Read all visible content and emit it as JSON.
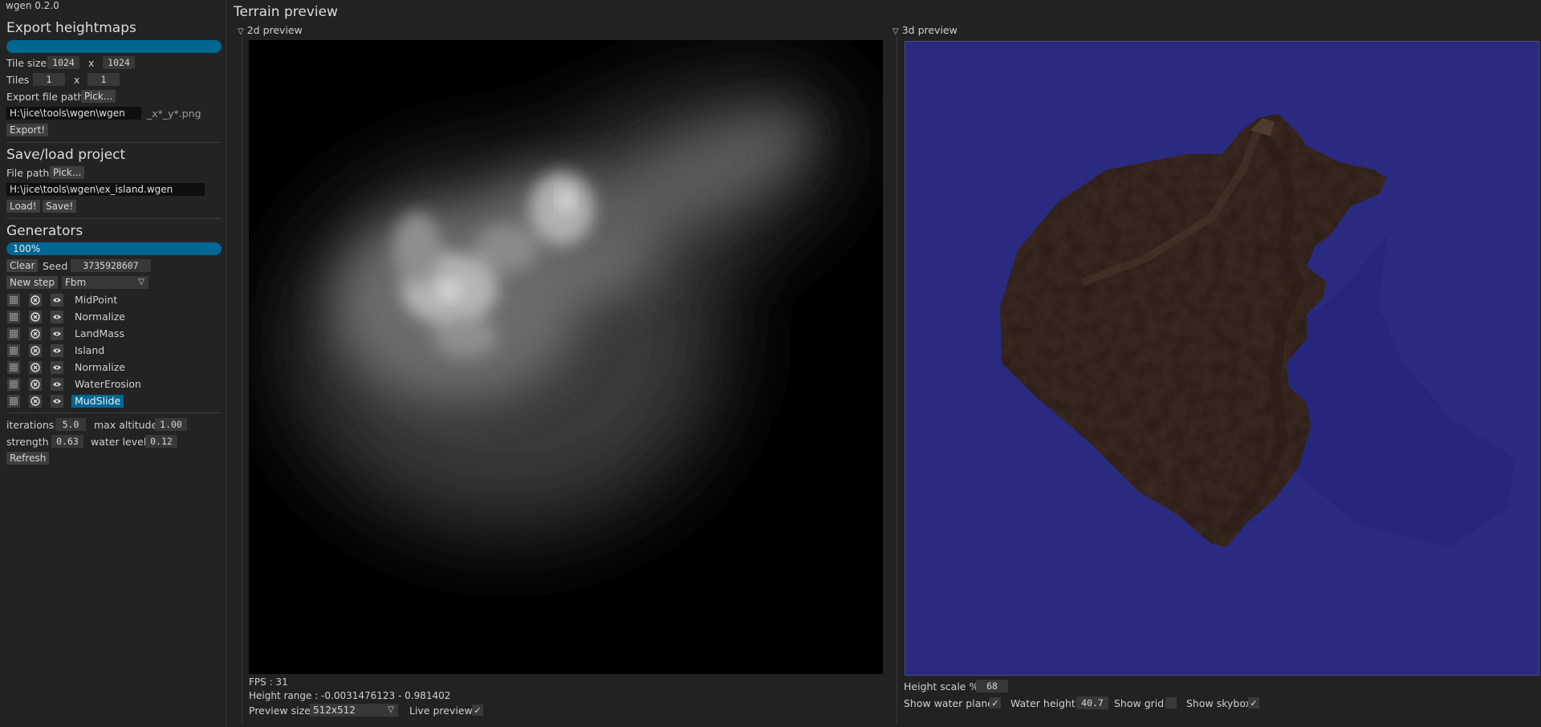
{
  "app": {
    "version": "wgen 0.2.0"
  },
  "export": {
    "title": "Export heightmaps",
    "tile_size_label": "Tile size",
    "tile_w": "1024",
    "tile_sep": "x",
    "tile_h": "1024",
    "tiles_label": "Tiles",
    "tiles_x": "1",
    "tiles_sep": "x",
    "tiles_y": "1",
    "path_label": "Export file path",
    "pick_label": "Pick...",
    "path_value": "H:\\jice\\tools\\wgen\\wgen",
    "suffix": "_x*_y*.png",
    "export_button": "Export!",
    "progress_fraction": 1.0
  },
  "project": {
    "title": "Save/load project",
    "path_label": "File path",
    "pick_label": "Pick...",
    "path_value": "H:\\jice\\tools\\wgen\\ex_island.wgen",
    "load_button": "Load!",
    "save_button": "Save!"
  },
  "generators": {
    "title": "Generators",
    "progress_text": "100%",
    "progress_fraction": 1.0,
    "clear_button": "Clear",
    "seed_label": "Seed",
    "seed_value": "3735928607",
    "new_step_button": "New step",
    "step_type": "Fbm",
    "steps": [
      {
        "label": "MidPoint",
        "selected": false
      },
      {
        "label": "Normalize",
        "selected": false
      },
      {
        "label": "LandMass",
        "selected": false
      },
      {
        "label": "Island",
        "selected": false
      },
      {
        "label": "Normalize",
        "selected": false
      },
      {
        "label": "WaterErosion",
        "selected": false
      },
      {
        "label": "MudSlide",
        "selected": true
      }
    ]
  },
  "params": {
    "iterations_label": "iterations",
    "iterations_value": "5.0",
    "max_altitude_label": "max altitude",
    "max_altitude_value": "1.00",
    "strength_label": "strength",
    "strength_value": "0.63",
    "water_level_label": "water level",
    "water_level_value": "0.12",
    "refresh_button": "Refresh"
  },
  "terrain": {
    "title": "Terrain preview",
    "preview2d": {
      "title": "2d preview",
      "fps": "FPS : 31",
      "height_range": "Height range : -0.0031476123 - 0.981402",
      "preview_size_label": "Preview size",
      "preview_size_value": "512x512",
      "live_preview_label": "Live preview",
      "live_preview_checked": true
    },
    "preview3d": {
      "title": "3d preview",
      "height_scale_label": "Height scale %",
      "height_scale_value": "68",
      "show_water_label": "Show water plane",
      "show_water_checked": true,
      "water_height_label": "Water height",
      "water_height_value": "40.7",
      "show_grid_label": "Show grid",
      "show_grid_checked": false,
      "show_skybox_label": "Show skybox",
      "show_skybox_checked": true
    }
  },
  "colors": {
    "accent": "#006793",
    "background": "#222222",
    "water": "#2a2a80",
    "land": "#3b2a22"
  }
}
